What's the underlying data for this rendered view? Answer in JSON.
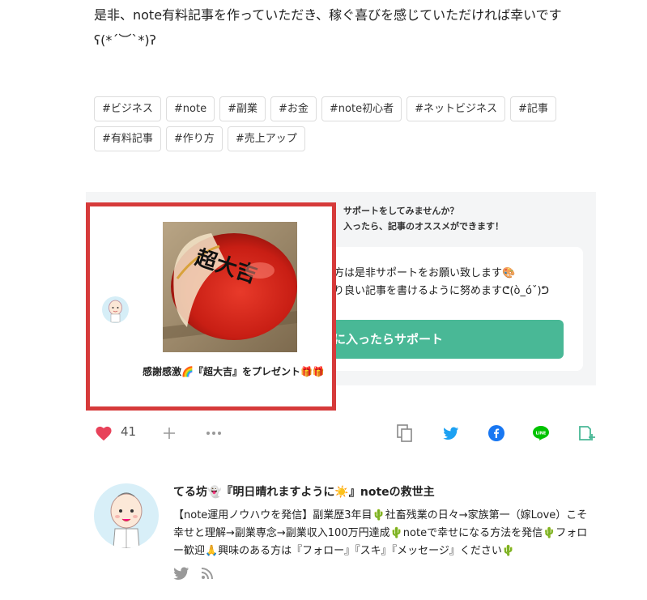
{
  "article": {
    "intro_text": "是非、note有料記事を作っていただき、稼ぐ喜びを感じていただければ幸いです",
    "kaomoji": "ʕ(*´︶`*)ʔ"
  },
  "tags": [
    "#ビジネス",
    "#note",
    "#副業",
    "#お金",
    "#note初心者",
    "#ネットビジネス",
    "#記事",
    "#有料記事",
    "#作り方",
    "#売上アップ"
  ],
  "support": {
    "question_line1": "サポートをしてみませんか？",
    "question_line2": "入ったら、記事のオススメができます！",
    "message_line1": "方は是非サポートをお願い致します🎨",
    "message_line2": "り良い記事を書けるように努めますᕦ(ò_óˇ)ᕤ",
    "button_label": "に入ったらサポート"
  },
  "gift": {
    "caption": "感謝感激🌈『超大吉』をプレゼント🎁🎁",
    "image_text": "超大吉"
  },
  "actions": {
    "like_count": "41"
  },
  "author": {
    "name": "てる坊👻『明日晴れますように☀️』noteの救世主",
    "bio": "【note運用ノウハウを発信】副業歴3年目🌵社畜残業の日々→家族第一（嫁Love）こそ幸せと理解→副業専念→副業収入100万円達成🌵noteで幸せになる方法を発信🌵フォロー歓迎🙏興味のある方は『フォロー』『スキ』『メッセージ』ください🌵"
  },
  "colors": {
    "highlight_border": "#d63a3a",
    "support_button": "#49b896",
    "like_heart": "#e8425a",
    "twitter": "#1da1f2",
    "facebook": "#1877f2",
    "line": "#00c300",
    "hatena": "#49b896"
  }
}
